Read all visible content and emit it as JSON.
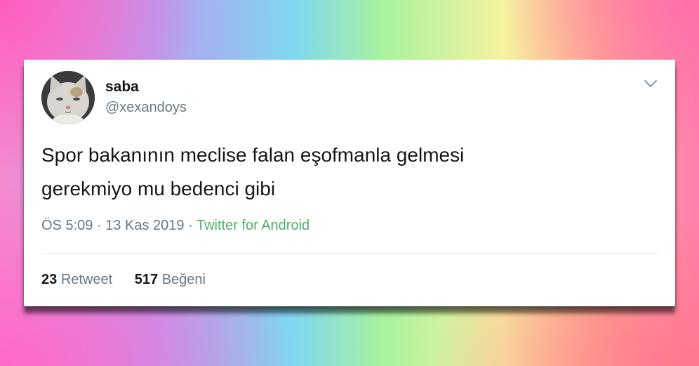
{
  "tweet": {
    "display_name": "saba",
    "handle": "@xexandoys",
    "text_line1": "Spor bakanının meclise falan eşofmanla gelmesi",
    "text_line2": "gerekmiyo mu bedenci gibi",
    "time": "ÖS 5:09",
    "date": "13 Kas 2019",
    "separator": "·",
    "source": "Twitter for Android",
    "retweet_count": "23",
    "retweet_label": "Retweet",
    "like_count": "517",
    "like_label": "Beğeni"
  },
  "icons": {
    "avatar": "cat-avatar",
    "menu": "chevron-down-icon"
  },
  "colors": {
    "source_link": "#4caf6a",
    "secondary_text": "#657786",
    "primary_text": "#14171a"
  }
}
